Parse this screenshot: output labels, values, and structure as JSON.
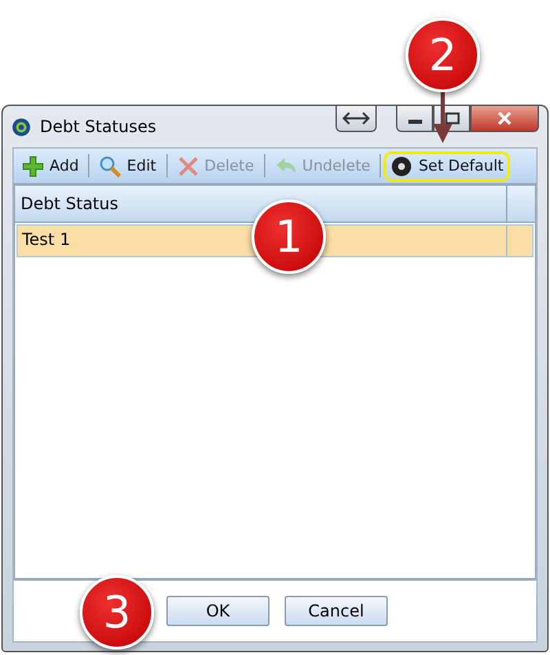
{
  "window": {
    "title": "Debt Statuses"
  },
  "toolbar": [
    {
      "kind": "add",
      "label": "Add",
      "disabled": false,
      "highlighted": false
    },
    {
      "kind": "edit",
      "label": "Edit",
      "disabled": false,
      "highlighted": false
    },
    {
      "kind": "delete",
      "label": "Delete",
      "disabled": true,
      "highlighted": false
    },
    {
      "kind": "undelete",
      "label": "Undelete",
      "disabled": true,
      "highlighted": false
    },
    {
      "kind": "default",
      "label": "Set Default",
      "disabled": false,
      "highlighted": true
    }
  ],
  "table": {
    "columns": [
      "Debt Status"
    ],
    "rows": [
      {
        "cells": [
          "Test 1"
        ],
        "selected": true
      }
    ]
  },
  "buttons": [
    "OK",
    "Cancel"
  ],
  "callouts": [
    {
      "number": "2",
      "kind": "arrowed"
    },
    {
      "number": "1",
      "kind": "plain"
    },
    {
      "number": "3",
      "kind": "plain"
    }
  ]
}
